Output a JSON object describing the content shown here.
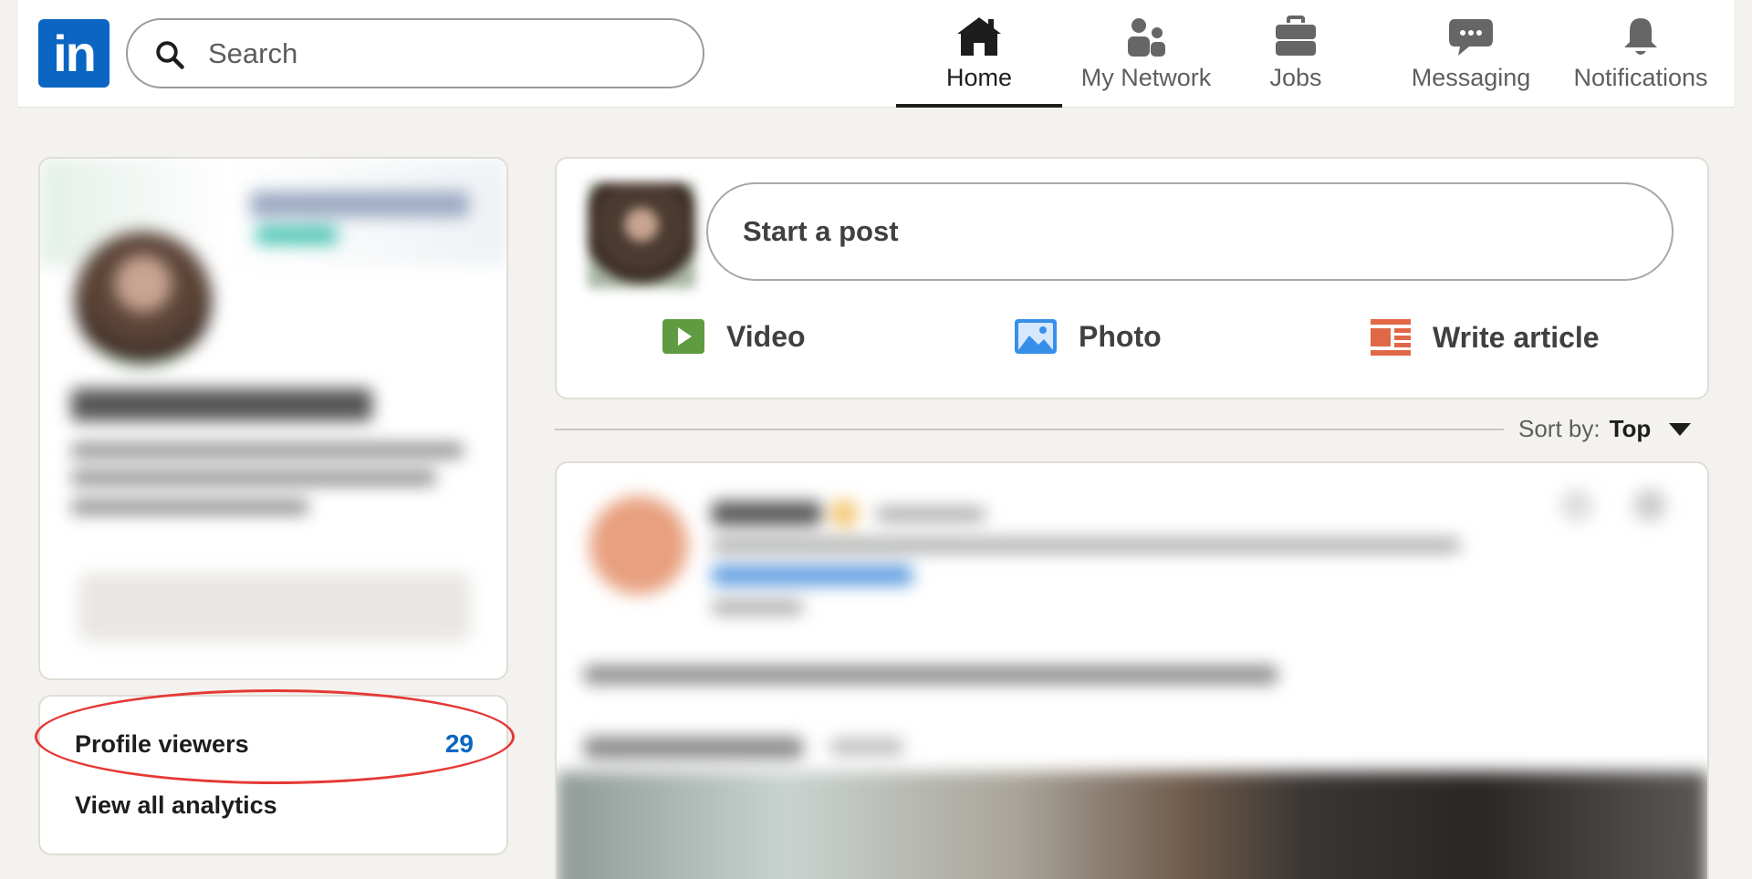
{
  "brand": {
    "logo_text": "in",
    "color": "#0a66c2"
  },
  "search": {
    "placeholder": "Search"
  },
  "nav": {
    "items": [
      {
        "label": "Home",
        "icon": "home-icon",
        "active": true
      },
      {
        "label": "My Network",
        "icon": "network-icon",
        "active": false
      },
      {
        "label": "Jobs",
        "icon": "briefcase-icon",
        "active": false
      },
      {
        "label": "Messaging",
        "icon": "messaging-icon",
        "active": false
      },
      {
        "label": "Notifications",
        "icon": "bell-icon",
        "active": false
      }
    ]
  },
  "analytics": {
    "profile_viewers_label": "Profile viewers",
    "profile_viewers_count": "29",
    "view_all_label": "View all analytics",
    "highlight_color": "#e53935"
  },
  "composer": {
    "start_post_label": "Start a post",
    "actions": [
      {
        "label": "Video",
        "icon": "video-icon",
        "color": "#5f9b41"
      },
      {
        "label": "Photo",
        "icon": "photo-icon",
        "color": "#378fe9"
      },
      {
        "label": "Write article",
        "icon": "article-icon",
        "color": "#e06847"
      }
    ]
  },
  "feed": {
    "sort_label": "Sort by:",
    "sort_value": "Top"
  }
}
